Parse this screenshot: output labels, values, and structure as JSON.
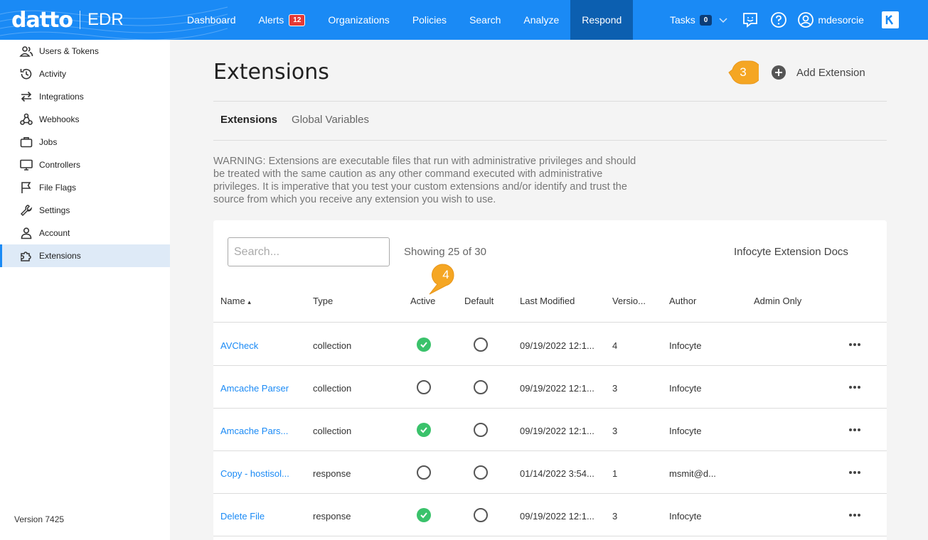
{
  "header": {
    "brand": "datto",
    "product": "EDR",
    "nav": [
      {
        "label": "Dashboard"
      },
      {
        "label": "Alerts",
        "badge": "12"
      },
      {
        "label": "Organizations"
      },
      {
        "label": "Policies"
      },
      {
        "label": "Search"
      },
      {
        "label": "Analyze"
      },
      {
        "label": "Respond",
        "active": true
      }
    ],
    "tasks_label": "Tasks",
    "tasks_count": "0",
    "username": "mdesorcie",
    "accent_color": "#1a8af5"
  },
  "sidebar": {
    "items": [
      {
        "label": "Users & Tokens",
        "icon": "users-icon"
      },
      {
        "label": "Activity",
        "icon": "history-icon"
      },
      {
        "label": "Integrations",
        "icon": "arrows-icon"
      },
      {
        "label": "Webhooks",
        "icon": "webhook-icon"
      },
      {
        "label": "Jobs",
        "icon": "briefcase-icon"
      },
      {
        "label": "Controllers",
        "icon": "monitor-icon"
      },
      {
        "label": "File Flags",
        "icon": "flag-icon"
      },
      {
        "label": "Settings",
        "icon": "wrench-icon"
      },
      {
        "label": "Account",
        "icon": "person-icon"
      },
      {
        "label": "Extensions",
        "icon": "puzzle-icon",
        "active": true
      }
    ],
    "version": "Version 7425"
  },
  "main": {
    "title": "Extensions",
    "add_label": "Add Extension",
    "callout_add": "3",
    "callout_active": "4",
    "tabs": [
      {
        "label": "Extensions",
        "active": true
      },
      {
        "label": "Global Variables"
      }
    ],
    "warning": "WARNING: Extensions are executable files that run with administrative privileges and should be treated with the same caution as any other command executed with administrative privileges. It is imperative that you test your custom extensions and/or identify and trust the source from which you receive any extension you wish to use.",
    "search_placeholder": "Search...",
    "showing": "Showing 25 of 30",
    "docs_link": "Infocyte Extension Docs"
  },
  "table": {
    "columns": [
      "Name",
      "Type",
      "Active",
      "Default",
      "Last Modified",
      "Versio...",
      "Author",
      "Admin Only"
    ],
    "sort_indicator": "▴",
    "rows": [
      {
        "name": "AVCheck",
        "type": "collection",
        "active": true,
        "default": false,
        "modified": "09/19/2022 12:1...",
        "version": "4",
        "author": "Infocyte"
      },
      {
        "name": "Amcache Parser",
        "type": "collection",
        "active": false,
        "default": false,
        "modified": "09/19/2022 12:1...",
        "version": "3",
        "author": "Infocyte"
      },
      {
        "name": "Amcache Pars...",
        "type": "collection",
        "active": true,
        "default": false,
        "modified": "09/19/2022 12:1...",
        "version": "3",
        "author": "Infocyte"
      },
      {
        "name": "Copy - hostisol...",
        "type": "response",
        "active": false,
        "default": false,
        "modified": "01/14/2022 3:54...",
        "version": "1",
        "author": "msmit@d..."
      },
      {
        "name": "Delete File",
        "type": "response",
        "active": true,
        "default": false,
        "modified": "09/19/2022 12:1...",
        "version": "3",
        "author": "Infocyte"
      }
    ]
  }
}
